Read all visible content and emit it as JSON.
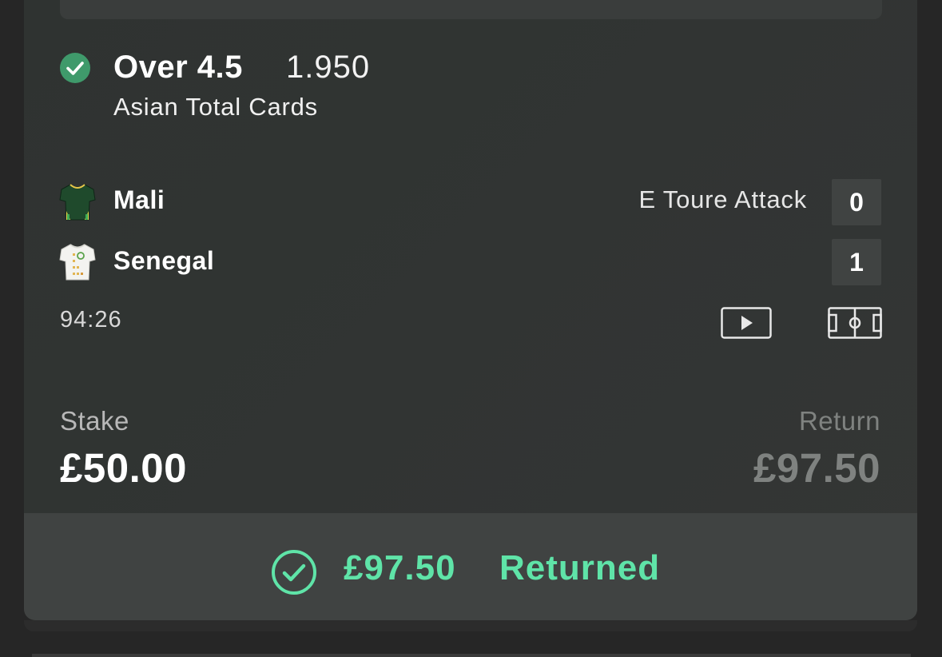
{
  "bet": {
    "status": "won",
    "selection": "Over 4.5",
    "odds": "1.950",
    "market": "Asian Total Cards"
  },
  "event": {
    "home_team": "Mali",
    "away_team": "Senegal",
    "home_score": "0",
    "away_score": "1",
    "live_event": "E Toure Attack",
    "clock": "94:26",
    "home_shirt_icon": "mali-shirt-icon",
    "away_shirt_icon": "senegal-shirt-icon",
    "video_icon": "play-video-icon",
    "pitch_icon": "match-pitch-icon"
  },
  "stake": {
    "label": "Stake",
    "value": "£50.00"
  },
  "return": {
    "label": "Return",
    "value": "£97.50"
  },
  "returned_banner": {
    "amount": "£97.50",
    "label": "Returned",
    "icon": "check-circle-icon"
  },
  "colors": {
    "accent_green": "#5fe4a8",
    "check_green": "#3f9a6b",
    "card_bg": "#313433",
    "score_bg": "#404342"
  }
}
